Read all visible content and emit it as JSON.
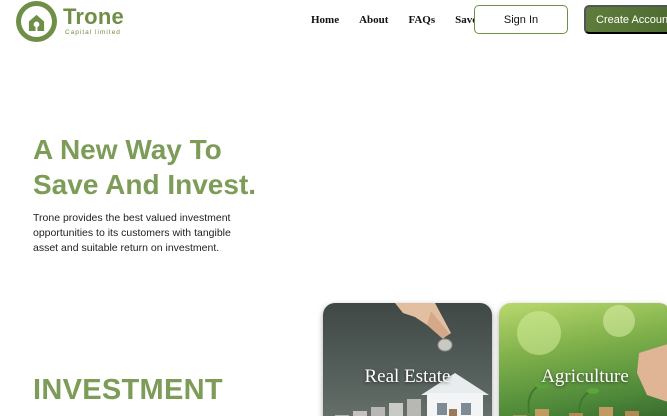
{
  "brand": {
    "name": "Trone",
    "tagline": "Capital limited",
    "color": "#6f8f47"
  },
  "nav": {
    "items": [
      {
        "label": "Home"
      },
      {
        "label": "About"
      },
      {
        "label": "FAQs"
      },
      {
        "label": "Save"
      }
    ],
    "sign_in": "Sign In",
    "create_account": "Create Account"
  },
  "hero": {
    "title_line1": "A New Way To",
    "title_line2": "Save And Invest.",
    "description": "Trone provides the best valued investment opportunities to its customers with tangible asset and suitable return on investment."
  },
  "investment": {
    "heading": "INVESTMENT",
    "cards": [
      {
        "label": "Real Estate",
        "image": "hand-coins-house-image"
      },
      {
        "label": "Agriculture",
        "image": "plant-coins-image"
      }
    ]
  },
  "colors": {
    "accent": "#7c9c58",
    "button_dark": "#4c6a2f"
  }
}
